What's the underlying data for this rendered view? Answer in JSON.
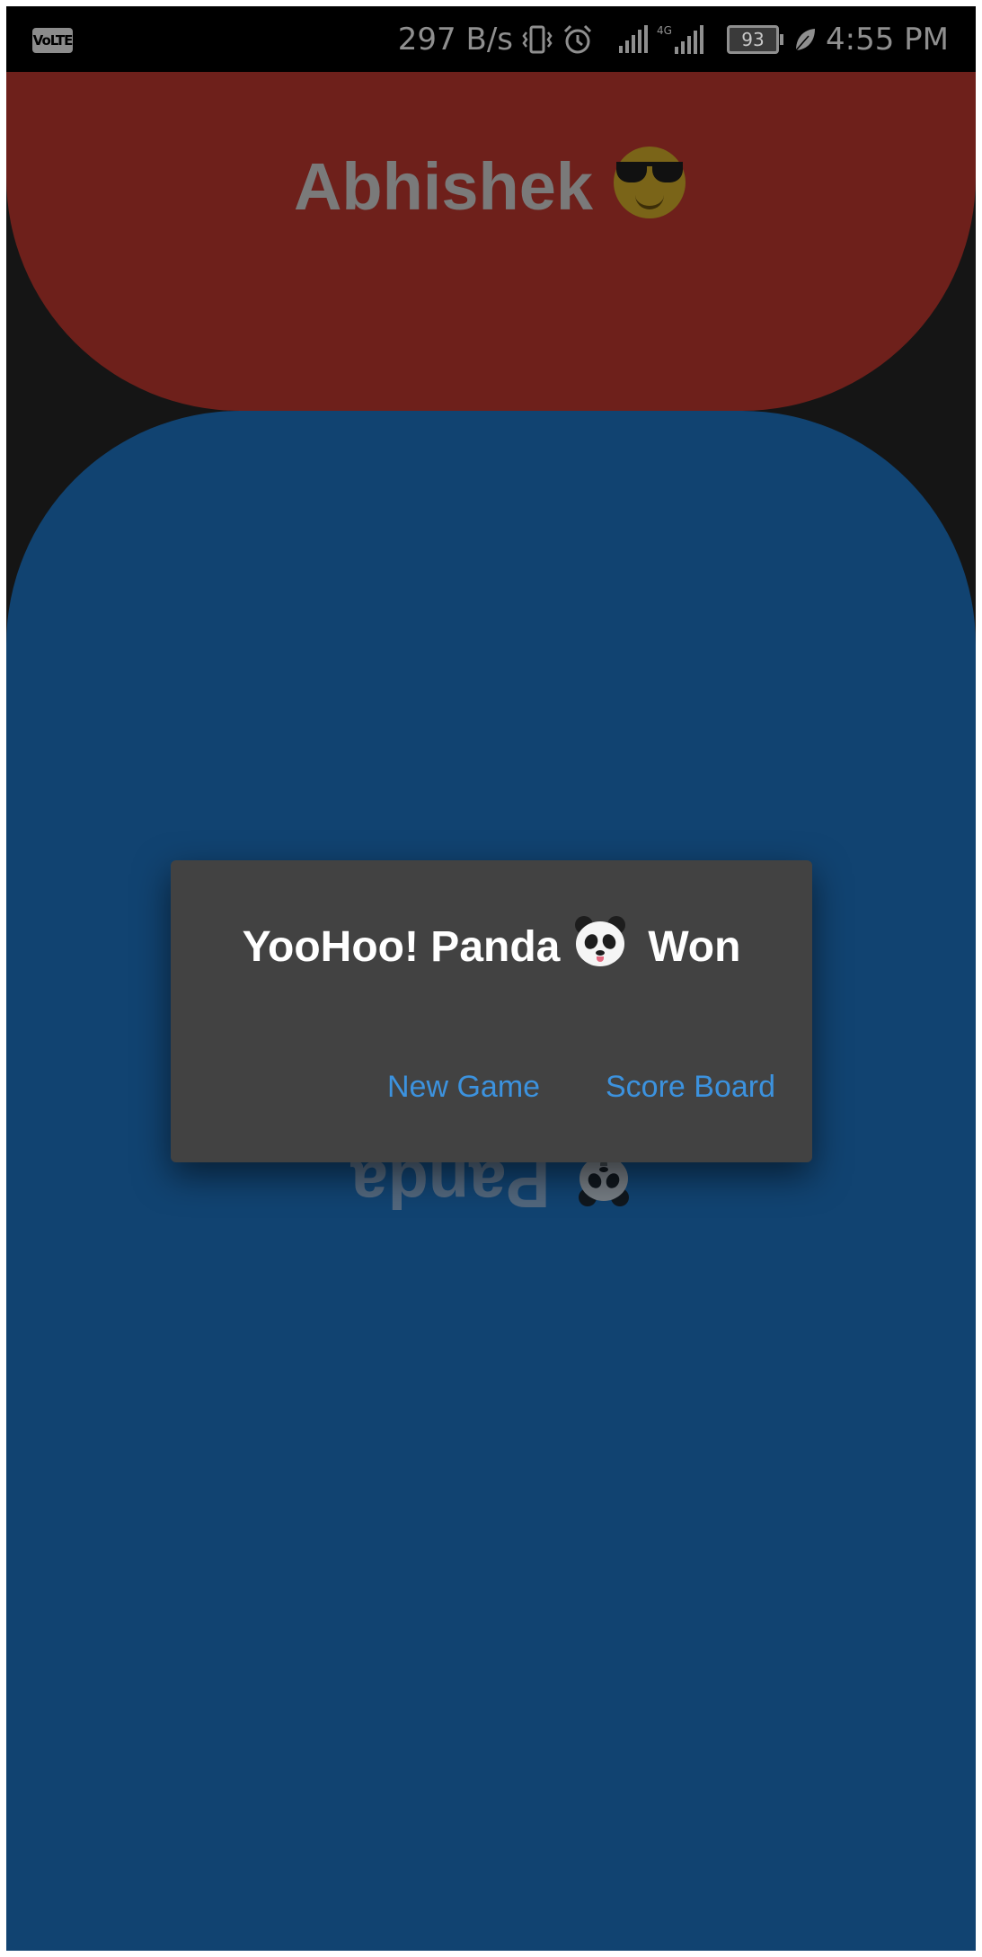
{
  "status_bar": {
    "volte": "VoLTE",
    "network_speed": "297 B/s",
    "network_type": "4G",
    "battery": "93",
    "time": "4:55 PM",
    "icons": [
      "vibrate-icon",
      "alarm-icon",
      "signal-icon",
      "signal-4g-icon",
      "battery-icon",
      "battery-saver-leaf-icon"
    ]
  },
  "players": {
    "top": {
      "name": "Abhishek",
      "emoji": "sunglasses-face-emoji"
    },
    "bottom": {
      "name": "Panda",
      "emoji": "panda-emoji"
    }
  },
  "dialog": {
    "title_prefix": "YooHoo! Panda",
    "title_suffix": "Won",
    "new_game_label": "New Game",
    "score_board_label": "Score Board"
  },
  "colors": {
    "top_panel": "#6e201b",
    "bottom_panel": "#114371",
    "dialog_background": "#424242",
    "dialog_button": "#3c92de"
  }
}
